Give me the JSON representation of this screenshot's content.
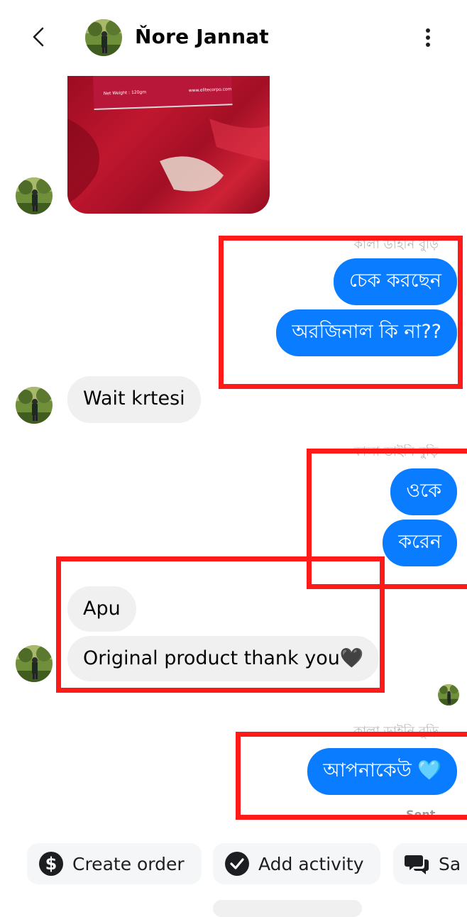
{
  "header": {
    "contact_name": "Ňore Jannat"
  },
  "photo": {
    "label_weight": "Net Weight : 120gm",
    "label_site": "www.elitecorpo.com"
  },
  "messages": {
    "faded_name": "কালা ডাইনি বুড়ি",
    "out_1": "চেক করছেন",
    "out_2": "অরজিনাল কি না??",
    "in_1": "Wait krtesi",
    "out_3": "ওকে",
    "out_4": "করেন",
    "in_2": "Apu",
    "in_3": "Original product thank you🖤",
    "out_5": "আপনাকেউ 🩵",
    "status": "Sent"
  },
  "actions": {
    "create_order": "Create order",
    "add_activity": "Add activity",
    "saved_replies": "Sa"
  },
  "colors": {
    "outgoing_bubble": "#0a7cff",
    "incoming_bubble": "#f0f0f0",
    "highlight_box": "#ff1a1a"
  }
}
